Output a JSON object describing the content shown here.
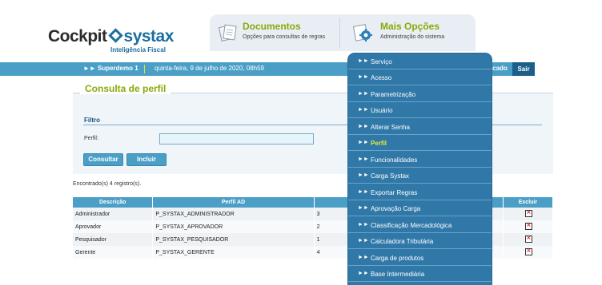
{
  "header": {
    "logo_main": "Cockpit",
    "logo_brand": "systax",
    "logo_sub": "Inteligência Fiscal",
    "tab_documentos_title": "Documentos",
    "tab_documentos_desc": "Opções para consultas de regras",
    "tab_mais_title": "Mais Opções",
    "tab_mais_desc": "Administração do sistema"
  },
  "bar": {
    "user": "Superdemo 1",
    "date": "quinta-feira, 9 de julho de 2020, 08h59",
    "mercado_partial": "rcado",
    "sair": "Sair"
  },
  "page": {
    "title": "Consulta de perfil",
    "filtro": "Filtro",
    "perfil_label": "Perfil:",
    "perfil_value": "",
    "consultar": "Consultar",
    "incluir": "Incluir",
    "found": "Encontrado(s) 4 registro(s)."
  },
  "table": {
    "headers": [
      "Descrição",
      "Perfil AD",
      "",
      "Excluir"
    ],
    "rows": [
      [
        "Administrador",
        "P_SYSTAX_ADMINISTRADOR",
        "3"
      ],
      [
        "Aprovador",
        "P_SYSTAX_APROVADOR",
        "2"
      ],
      [
        "Pesquisador",
        "P_SYSTAX_PESQUISADOR",
        "1"
      ],
      [
        "Gerente",
        "P_SYSTAX_GERENTE",
        "4"
      ]
    ]
  },
  "menu": {
    "items": [
      "Serviço",
      "Acesso",
      "Parametrização",
      "Usuário",
      "Alterar Senha",
      "Perfil",
      "Funcionalidades",
      "Carga Systax",
      "Exportar Regras",
      "Aprovação Carga",
      "Classificação Mercadológica",
      "Calculadora Tributária",
      "Carga de produtos",
      "Base Intermediária"
    ],
    "active_index": 5,
    "arrow": "►►"
  },
  "colors": {
    "accent_green": "#8aa80a",
    "brand_blue": "#1d6fa0",
    "bar_blue": "#4b9fc7",
    "menu_blue": "#3078a8"
  }
}
